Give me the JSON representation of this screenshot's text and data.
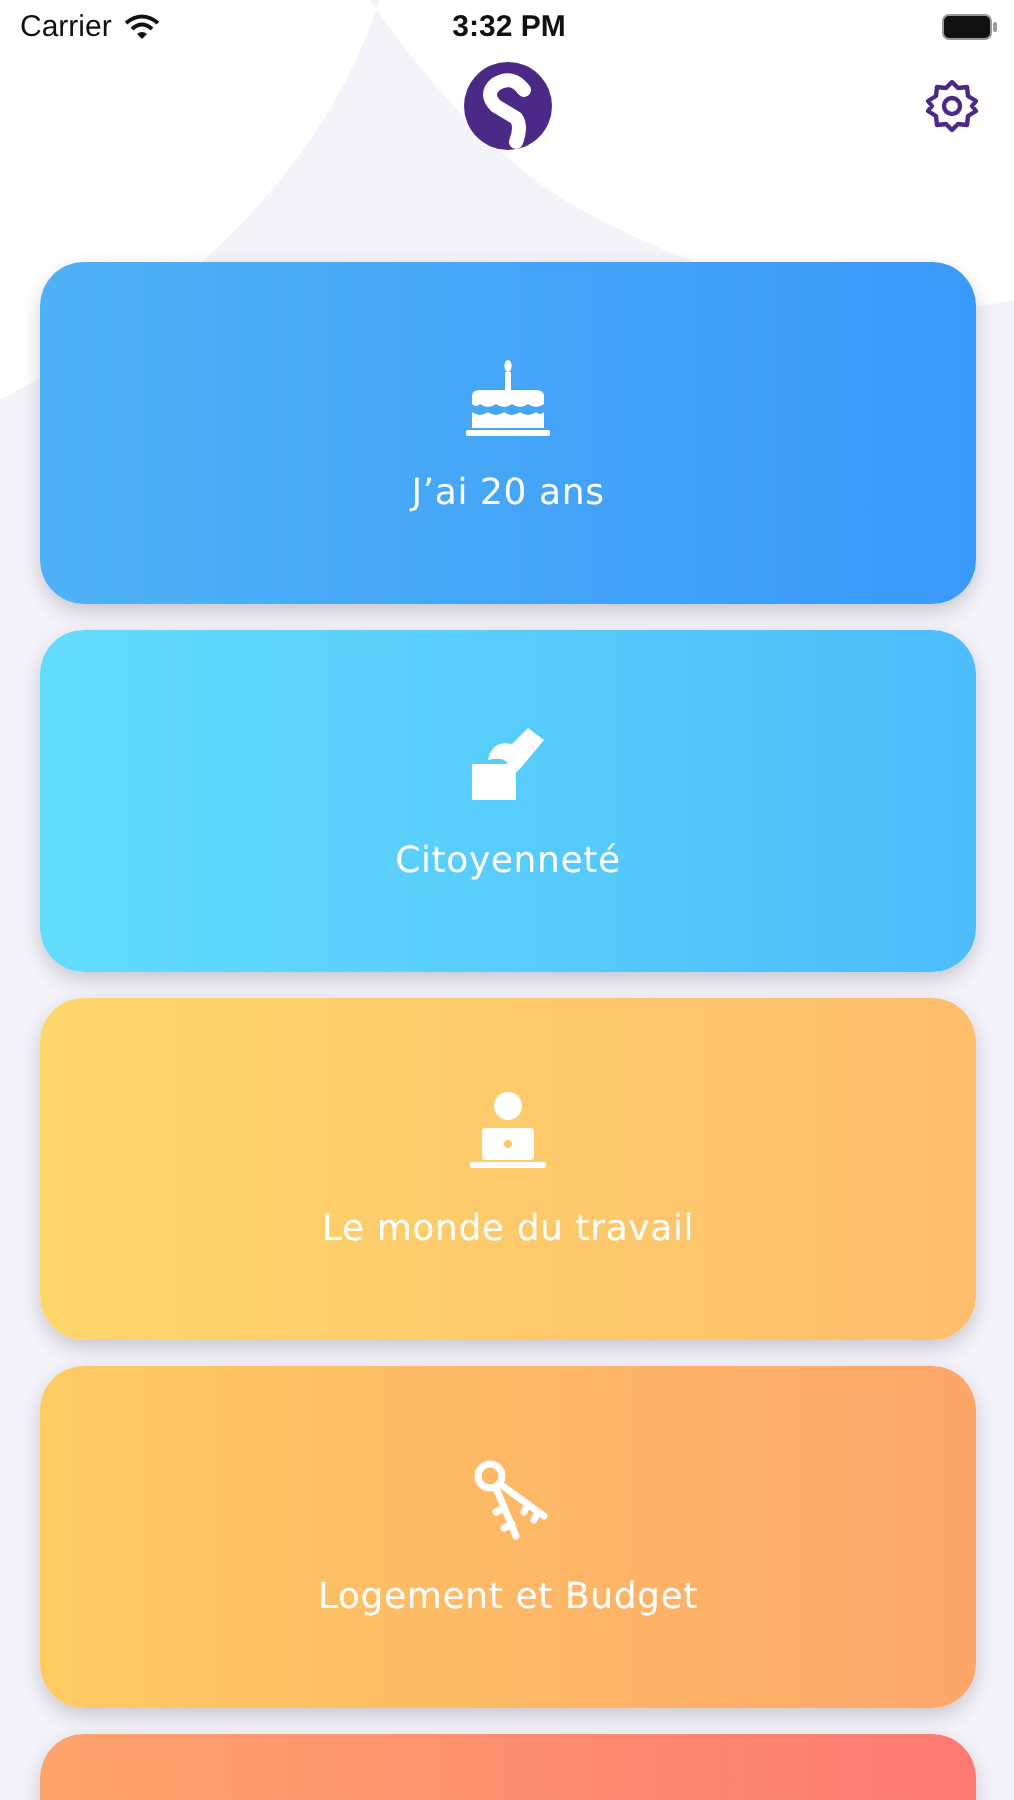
{
  "status_bar": {
    "carrier": "Carrier",
    "time": "3:32 PM"
  },
  "cards": [
    {
      "kind": "cake",
      "title": "J’ai 20 ans"
    },
    {
      "kind": "ballot",
      "title": "Citoyenneté"
    },
    {
      "kind": "laptop",
      "title": "Le monde du travail"
    },
    {
      "kind": "keys",
      "title": "Logement et Budget"
    },
    {
      "kind": "coral"
    }
  ]
}
